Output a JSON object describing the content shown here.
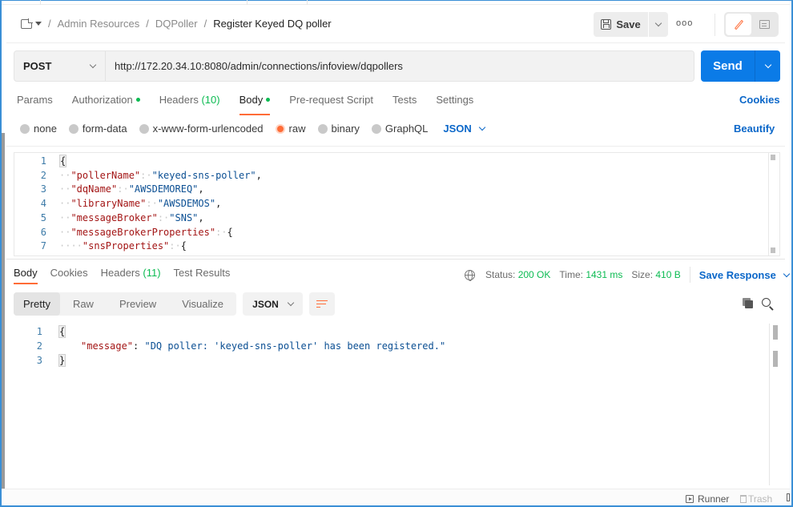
{
  "breadcrumb": {
    "items": [
      "Admin Resources",
      "DQPoller"
    ],
    "current": "Register Keyed DQ poller"
  },
  "header": {
    "save_label": "Save",
    "more_label": "ooo"
  },
  "request": {
    "method": "POST",
    "url": "http://172.20.34.10:8080/admin/connections/infoview/dqpollers",
    "send_label": "Send"
  },
  "request_tabs": {
    "params": "Params",
    "authorization": "Authorization",
    "headers": "Headers",
    "headers_count": "(10)",
    "body": "Body",
    "prerequest": "Pre-request Script",
    "tests": "Tests",
    "settings": "Settings",
    "cookies": "Cookies"
  },
  "body_types": {
    "options": [
      "none",
      "form-data",
      "x-www-form-urlencoded",
      "raw",
      "binary",
      "GraphQL"
    ],
    "selected": "raw",
    "language": "JSON",
    "beautify": "Beautify"
  },
  "request_body": {
    "lines": [
      {
        "n": "1",
        "indent": "",
        "key": "",
        "sep": "",
        "val": "",
        "tail": "{"
      },
      {
        "n": "2",
        "indent": "··",
        "key": "\"pollerName\"",
        "sep": ":·",
        "val": "\"keyed-sns-poller\"",
        "tail": ","
      },
      {
        "n": "3",
        "indent": "··",
        "key": "\"dqName\"",
        "sep": ":·",
        "val": "\"AWSDEMOREQ\"",
        "tail": ","
      },
      {
        "n": "4",
        "indent": "··",
        "key": "\"libraryName\"",
        "sep": ":·",
        "val": "\"AWSDEMOS\"",
        "tail": ","
      },
      {
        "n": "5",
        "indent": "··",
        "key": "\"messageBroker\"",
        "sep": ":·",
        "val": "\"SNS\"",
        "tail": ","
      },
      {
        "n": "6",
        "indent": "··",
        "key": "\"messageBrokerProperties\"",
        "sep": ":·",
        "val": "",
        "tail": "{"
      },
      {
        "n": "7",
        "indent": "····",
        "key": "\"snsProperties\"",
        "sep": ":·",
        "val": "",
        "tail": "{"
      }
    ]
  },
  "response_tabs": {
    "body": "Body",
    "cookies": "Cookies",
    "headers": "Headers",
    "headers_count": "(11)",
    "test_results": "Test Results"
  },
  "response_meta": {
    "status_label": "Status:",
    "status_value": "200 OK",
    "time_label": "Time:",
    "time_value": "1431 ms",
    "size_label": "Size:",
    "size_value": "410 B",
    "save_response": "Save Response"
  },
  "response_view": {
    "modes": [
      "Pretty",
      "Raw",
      "Preview",
      "Visualize"
    ],
    "active_mode": "Pretty",
    "language": "JSON"
  },
  "response_body": {
    "lines": [
      {
        "n": "1",
        "text": "{"
      },
      {
        "n": "2",
        "key": "\"message\"",
        "sep": ": ",
        "val": "\"DQ poller: 'keyed-sns-poller' has been registered.\""
      },
      {
        "n": "3",
        "text": "}"
      }
    ]
  },
  "footer": {
    "runner": "Runner",
    "trash": "Trash"
  },
  "colors": {
    "accent": "#ff6c37",
    "primary": "#0b7be7",
    "link": "#0b67c9",
    "success": "#0cbb52"
  }
}
